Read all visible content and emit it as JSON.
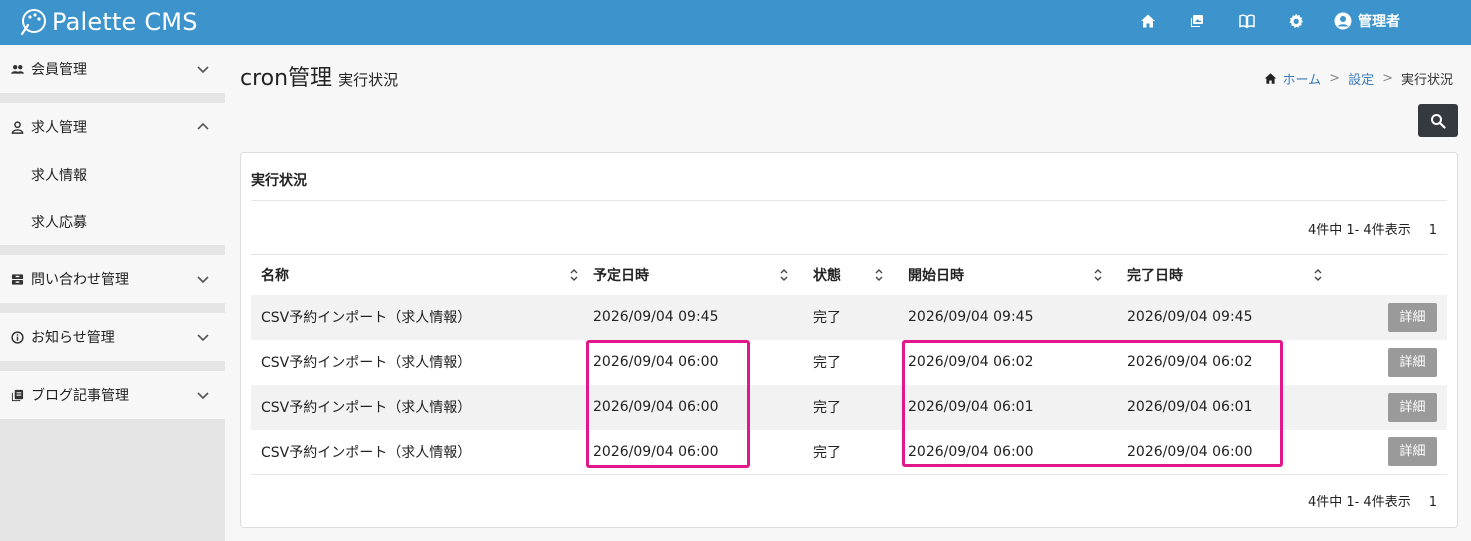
{
  "app": {
    "name": "Palette CMS"
  },
  "header": {
    "user_label": "管理者",
    "icons": [
      "home-icon",
      "gallery-icon",
      "book-icon",
      "gear-icon",
      "user-circle-icon"
    ]
  },
  "sidebar": {
    "items": [
      {
        "label": "会員管理",
        "icon": "users-icon",
        "expanded": false
      },
      {
        "label": "求人管理",
        "icon": "user-icon",
        "expanded": true,
        "children": [
          "求人情報",
          "求人応募"
        ]
      },
      {
        "label": "問い合わせ管理",
        "icon": "inbox-icon",
        "expanded": false
      },
      {
        "label": "お知らせ管理",
        "icon": "info-icon",
        "expanded": false
      },
      {
        "label": "ブログ記事管理",
        "icon": "copy-icon",
        "expanded": false
      }
    ]
  },
  "page": {
    "title": "cron管理",
    "subtitle": "実行状況"
  },
  "breadcrumb": {
    "home": "ホーム",
    "settings": "設定",
    "current": "実行状況"
  },
  "card": {
    "title": "実行状況",
    "pager_text": "4件中 1- 4件表示",
    "page_number": "1"
  },
  "table": {
    "headers": [
      "名称",
      "予定日時",
      "状態",
      "開始日時",
      "完了日時"
    ],
    "detail_label": "詳細",
    "rows": [
      {
        "name": "CSV予約インポート（求人情報）",
        "scheduled": "2026/09/04 09:45",
        "status": "完了",
        "start": "2026/09/04 09:45",
        "end": "2026/09/04 09:45"
      },
      {
        "name": "CSV予約インポート（求人情報）",
        "scheduled": "2026/09/04 06:00",
        "status": "完了",
        "start": "2026/09/04 06:02",
        "end": "2026/09/04 06:02"
      },
      {
        "name": "CSV予約インポート（求人情報）",
        "scheduled": "2026/09/04 06:00",
        "status": "完了",
        "start": "2026/09/04 06:01",
        "end": "2026/09/04 06:01"
      },
      {
        "name": "CSV予約インポート（求人情報）",
        "scheduled": "2026/09/04 06:00",
        "status": "完了",
        "start": "2026/09/04 06:00",
        "end": "2026/09/04 06:00"
      }
    ]
  },
  "colors": {
    "header": "#3d94cc",
    "highlight": "#e0188c",
    "detail_button": "#9a9a9a",
    "search_button": "#343a40"
  }
}
